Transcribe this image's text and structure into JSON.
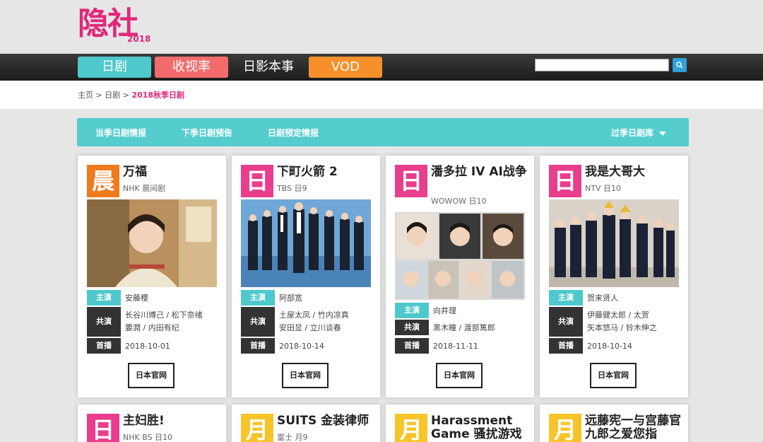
{
  "logo": {
    "text": "隐社",
    "year": "2018"
  },
  "nav": {
    "items": [
      "日剧",
      "收视率",
      "日影本事",
      "VOD"
    ]
  },
  "search": {
    "placeholder": "",
    "button_icon": "search-icon"
  },
  "breadcrumb": {
    "home": "主页",
    "sep": ">",
    "level1": "日剧",
    "current": "2018秋季日剧"
  },
  "subnav": {
    "items": [
      "当季日剧情报",
      "下季日剧预告",
      "日剧预定情报"
    ],
    "archive": "过季日剧库"
  },
  "labels": {
    "lead": "主演",
    "costar": "共演",
    "premiere": "首播",
    "official": "日本官网"
  },
  "cards": [
    {
      "badge": "晨",
      "title": "万福",
      "network": "NHK 晨间剧",
      "lead": "安藤樱",
      "costar1": "长谷川博己 / 松下奈绪",
      "costar2": "要潤 / 内田有纪",
      "date": "2018-10-01"
    },
    {
      "badge": "日",
      "title": "下町火箭 2",
      "network": "TBS 日9",
      "lead": "阿部宽",
      "costar1": "土屋太凤 / 竹内凉真",
      "costar2": "安田显 / 立川谈春",
      "date": "2018-10-14"
    },
    {
      "badge": "日",
      "title": "潘多拉 IV AI战争",
      "network": "WOWOW 日10",
      "lead": "向井理",
      "costar1": "黑木瞳 / 渡部篤郎",
      "costar2": "",
      "date": "2018-11-11"
    },
    {
      "badge": "日",
      "title": "我是大哥大",
      "network": "NTV 日10",
      "lead": "贺来贤人",
      "costar1": "伊藤健太郎 / 太贺",
      "costar2": "矢本悠马 / 铃木伸之",
      "date": "2018-10-14"
    }
  ],
  "cards_row2": [
    {
      "badge": "日",
      "title": "主妇胜!",
      "network": "NHK BS 日10"
    },
    {
      "badge": "月",
      "title": "SUITS 金装律师",
      "network": "富士 月9"
    },
    {
      "badge": "月",
      "title": "Harassment Game 骚扰游戏",
      "network": ""
    },
    {
      "badge": "月",
      "title": "远藤宪一与宫藤官九郎之爱您指",
      "network": ""
    }
  ],
  "colors": {
    "accent_teal": "#55cdcf",
    "pink": "#e83e8c",
    "orange": "#f07a1e",
    "yellow": "#f7c52a"
  }
}
